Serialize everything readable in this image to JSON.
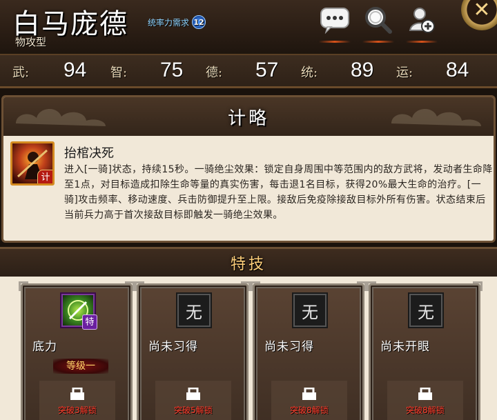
{
  "hero": {
    "name": "白马庞德",
    "type": "物攻型",
    "requirement_label": "统率力需求",
    "requirement_value": "12"
  },
  "header_icons": [
    "chat-bubble-icon",
    "magnifier-icon",
    "add-person-icon",
    "close-icon"
  ],
  "stats": [
    {
      "label": "武:",
      "value": "94"
    },
    {
      "label": "智:",
      "value": "75"
    },
    {
      "label": "德:",
      "value": "57"
    },
    {
      "label": "统:",
      "value": "89"
    },
    {
      "label": "运:",
      "value": "84"
    }
  ],
  "strategy": {
    "title": "计略",
    "skill": {
      "name": "抬棺决死",
      "badge": "计",
      "description": "进入[一骑]状态，持续15秒。一骑绝尘效果：锁定自身周围中等范围内的敌方武将，发动者生命降至1点，对目标造成扣除生命等量的真实伤害，每击退1名目标，获得20%最大生命的治疗。[一骑]攻击频率、移动速度、兵击防御提升至上限。接敌后免疫除接敌目标外所有伤害。状态结束后当前兵力高于首次接敌目标即触发一骑绝尘效果。"
    }
  },
  "specialty": {
    "title": "特技",
    "cards": [
      {
        "name": "底力",
        "icon_glyph": "",
        "tag": "特",
        "level": "等级一",
        "unlock": "突破3解锁",
        "active": true
      },
      {
        "name": "尚未习得",
        "icon_glyph": "无",
        "tag": "",
        "level": "",
        "unlock": "突破5解锁",
        "active": false
      },
      {
        "name": "尚未习得",
        "icon_glyph": "无",
        "tag": "",
        "level": "",
        "unlock": "突破8解锁",
        "active": false
      },
      {
        "name": "尚未开眼",
        "icon_glyph": "无",
        "tag": "",
        "level": "",
        "unlock": "突破8解锁",
        "active": false
      }
    ]
  },
  "colors": {
    "panel_bg": "#f1e8d8",
    "header_bg": "#2a1d14",
    "unlock_text": "#ff3a2a",
    "level_text": "#ffd76a",
    "specialty_title": "#ffcf7a"
  }
}
